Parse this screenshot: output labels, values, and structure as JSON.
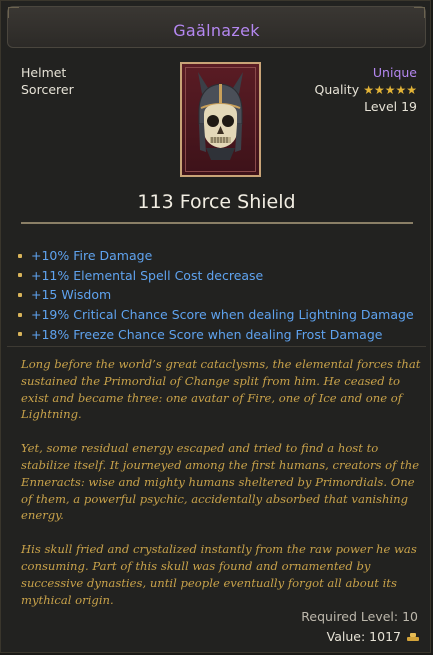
{
  "item": {
    "name": "Gaälnazek",
    "slot": "Helmet",
    "class": "Sorcerer",
    "rarity": "Unique",
    "quality_label": "Quality",
    "quality_stars": 5,
    "quality_stars_text": "★★★★★",
    "level_label": "Level 19",
    "force_shield": "113 Force Shield",
    "icon": "skull-helmet-icon"
  },
  "modifiers": [
    "+10% Fire Damage",
    "+11% Elemental Spell Cost decrease",
    "+15 Wisdom",
    "+19% Critical Chance Score when dealing Lightning Damage",
    "+18% Freeze Chance Score when dealing Frost Damage"
  ],
  "lore": [
    "Long before the world’s great cataclysms, the elemental forces that sustained the Primordial of Change split from him. He ceased to exist and became three: one avatar of Fire, one of Ice and one of Lightning.",
    "Yet, some residual energy escaped and tried to find a host to stabilize itself. It journeyed among the first humans, creators of the Enneracts: wise and mighty humans sheltered by Primordials. One of them, a powerful psychic, accidentally absorbed that vanishing energy.",
    "His skull fried and crystalized instantly from the raw power he was consuming. Part of this skull was found and ornamented by successive dynasties, until people eventually forgot all about its mythical origin."
  ],
  "footer": {
    "required_level": "Required Level: 10",
    "value": "Value: 1017",
    "coin_icon": "gold-coins-icon"
  },
  "colors": {
    "unique": "#b487f0",
    "modifier": "#5fa3ef",
    "lore": "#c8a24a",
    "star": "#e3b437",
    "portrait_bg": "#5a1c24",
    "portrait_border": "#c9a477"
  }
}
